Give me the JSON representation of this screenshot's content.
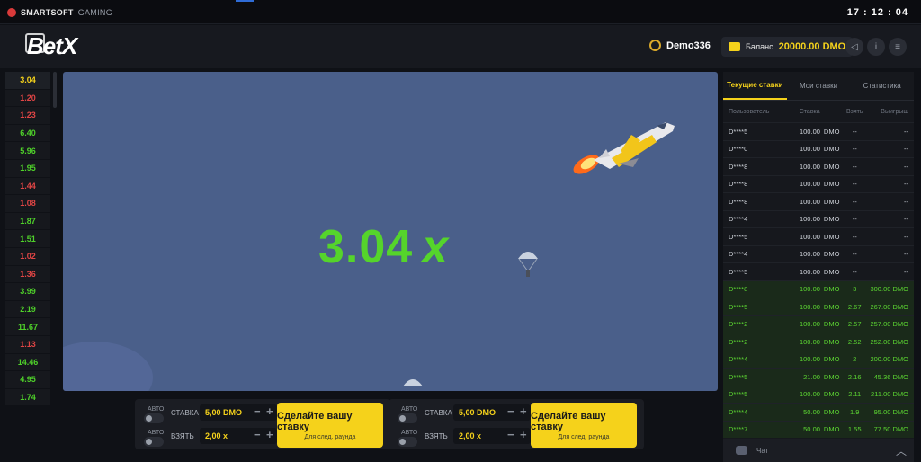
{
  "topbar": {
    "brand": "SMARTSOFT",
    "brand_sub": "GAMING",
    "clock": "17 : 12 : 04"
  },
  "header": {
    "logo": "BetX",
    "username": "Demo336",
    "balance_label": "Баланс",
    "balance_value": "20000.00 DMO"
  },
  "history": [
    {
      "v": "3.04",
      "c": "#f5d21b"
    },
    {
      "v": "1.20",
      "c": "#e04545"
    },
    {
      "v": "1.23",
      "c": "#e04545"
    },
    {
      "v": "6.40",
      "c": "#4fd12a"
    },
    {
      "v": "5.96",
      "c": "#4fd12a"
    },
    {
      "v": "1.95",
      "c": "#4fd12a"
    },
    {
      "v": "1.44",
      "c": "#e04545"
    },
    {
      "v": "1.08",
      "c": "#e04545"
    },
    {
      "v": "1.87",
      "c": "#4fd12a"
    },
    {
      "v": "1.51",
      "c": "#4fd12a"
    },
    {
      "v": "1.02",
      "c": "#e04545"
    },
    {
      "v": "1.36",
      "c": "#e04545"
    },
    {
      "v": "3.99",
      "c": "#4fd12a"
    },
    {
      "v": "2.19",
      "c": "#4fd12a"
    },
    {
      "v": "11.67",
      "c": "#4fd12a"
    },
    {
      "v": "1.13",
      "c": "#e04545"
    },
    {
      "v": "14.46",
      "c": "#4fd12a"
    },
    {
      "v": "4.95",
      "c": "#4fd12a"
    },
    {
      "v": "1.74",
      "c": "#4fd12a"
    }
  ],
  "game": {
    "multiplier": "3.04",
    "multiplier_suffix": "x"
  },
  "bet_panels": [
    {
      "auto": "АВТО",
      "stake_label": "СТАВКА",
      "stake_value": "5,00 DMO",
      "take_label": "ВЗЯТЬ",
      "take_value": "2,00 x",
      "button_title": "Сделайте вашу ставку",
      "button_sub": "Для след. раунда"
    },
    {
      "auto": "АВТО",
      "stake_label": "СТАВКА",
      "stake_value": "5,00 DMO",
      "take_label": "ВЗЯТЬ",
      "take_value": "2,00 x",
      "button_title": "Сделайте вашу ставку",
      "button_sub": "Для след. раунда"
    }
  ],
  "right_panel": {
    "tabs": [
      "Текущие ставки",
      "Мои ставки",
      "Статистика"
    ],
    "columns": [
      "Пользователь",
      "Ставка",
      "Взять",
      "Выигрыш"
    ],
    "rows": [
      {
        "user": "D****5",
        "bet": "100.00",
        "cur": "DMO",
        "take": "--",
        "win": "--",
        "won": false
      },
      {
        "user": "D****0",
        "bet": "100.00",
        "cur": "DMO",
        "take": "--",
        "win": "--",
        "won": false
      },
      {
        "user": "D****8",
        "bet": "100.00",
        "cur": "DMO",
        "take": "--",
        "win": "--",
        "won": false
      },
      {
        "user": "D****8",
        "bet": "100.00",
        "cur": "DMO",
        "take": "--",
        "win": "--",
        "won": false
      },
      {
        "user": "D****8",
        "bet": "100.00",
        "cur": "DMO",
        "take": "--",
        "win": "--",
        "won": false
      },
      {
        "user": "D****4",
        "bet": "100.00",
        "cur": "DMO",
        "take": "--",
        "win": "--",
        "won": false
      },
      {
        "user": "D****5",
        "bet": "100.00",
        "cur": "DMO",
        "take": "--",
        "win": "--",
        "won": false
      },
      {
        "user": "D****4",
        "bet": "100.00",
        "cur": "DMO",
        "take": "--",
        "win": "--",
        "won": false
      },
      {
        "user": "D****5",
        "bet": "100.00",
        "cur": "DMO",
        "take": "--",
        "win": "--",
        "won": false
      },
      {
        "user": "D****8",
        "bet": "100.00",
        "cur": "DMO",
        "take": "3",
        "win": "300.00 DMO",
        "won": true
      },
      {
        "user": "D****5",
        "bet": "100.00",
        "cur": "DMO",
        "take": "2.67",
        "win": "267.00 DMO",
        "won": true
      },
      {
        "user": "D****2",
        "bet": "100.00",
        "cur": "DMO",
        "take": "2.57",
        "win": "257.00 DMO",
        "won": true
      },
      {
        "user": "D****2",
        "bet": "100.00",
        "cur": "DMO",
        "take": "2.52",
        "win": "252.00 DMO",
        "won": true
      },
      {
        "user": "D****4",
        "bet": "100.00",
        "cur": "DMO",
        "take": "2",
        "win": "200.00 DMO",
        "won": true
      },
      {
        "user": "D****5",
        "bet": "21.00",
        "cur": "DMO",
        "take": "2.16",
        "win": "45.36 DMO",
        "won": true
      },
      {
        "user": "D****5",
        "bet": "100.00",
        "cur": "DMO",
        "take": "2.11",
        "win": "211.00 DMO",
        "won": true
      },
      {
        "user": "D****4",
        "bet": "50.00",
        "cur": "DMO",
        "take": "1.9",
        "win": "95.00 DMO",
        "won": true
      },
      {
        "user": "D****7",
        "bet": "50.00",
        "cur": "DMO",
        "take": "1.55",
        "win": "77.50 DMO",
        "won": true
      }
    ],
    "chat_label": "Чат"
  }
}
